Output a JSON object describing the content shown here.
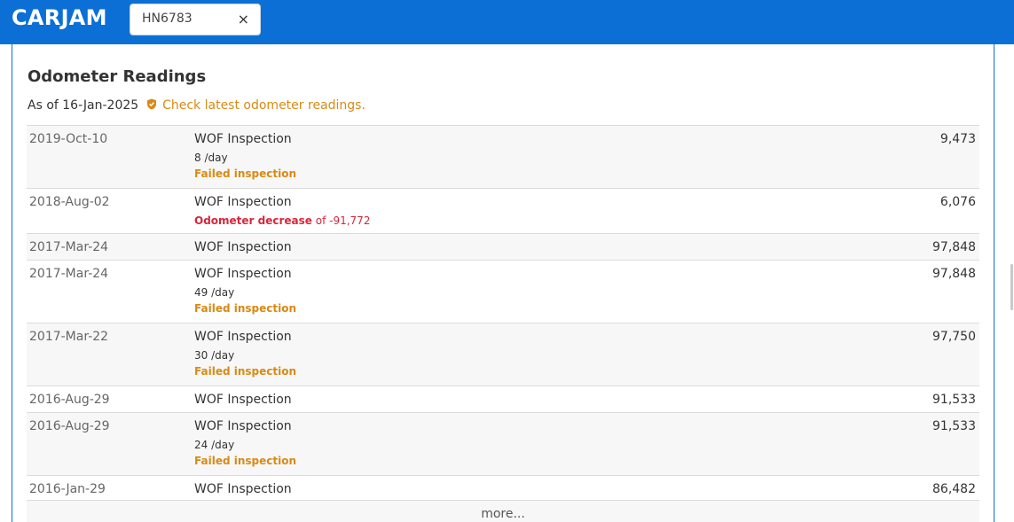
{
  "header": {
    "logo": "CARJAM",
    "search_value": "HN6783",
    "clear_glyph": "×"
  },
  "section": {
    "title": "Odometer Readings",
    "as_of": "As of 16-Jan-2025",
    "check_link": "Check latest odometer readings."
  },
  "rows": [
    {
      "date": "2019-Oct-10",
      "type": "WOF Inspection",
      "rate": "8 /day",
      "note": "Failed inspection",
      "reading": "9,473"
    },
    {
      "date": "2018-Aug-02",
      "type": "WOF Inspection",
      "decrease_label": "Odometer decrease",
      "decrease_value": " of -91,772",
      "reading": "6,076"
    },
    {
      "date": "2017-Mar-24",
      "type": "WOF Inspection",
      "reading": "97,848"
    },
    {
      "date": "2017-Mar-24",
      "type": "WOF Inspection",
      "rate": "49 /day",
      "note": "Failed inspection",
      "reading": "97,848"
    },
    {
      "date": "2017-Mar-22",
      "type": "WOF Inspection",
      "rate": "30 /day",
      "note": "Failed inspection",
      "reading": "97,750"
    },
    {
      "date": "2016-Aug-29",
      "type": "WOF Inspection",
      "reading": "91,533"
    },
    {
      "date": "2016-Aug-29",
      "type": "WOF Inspection",
      "rate": "24 /day",
      "note": "Failed inspection",
      "reading": "91,533"
    },
    {
      "date": "2016-Jan-29",
      "type": "WOF Inspection",
      "reading": "86,482"
    }
  ],
  "more_label": "more...",
  "colors": {
    "brand": "#0c6fd6",
    "warning": "#d98a14",
    "danger": "#d9253a"
  },
  "icons": {
    "shield": "shield-icon",
    "clear": "close-icon"
  }
}
